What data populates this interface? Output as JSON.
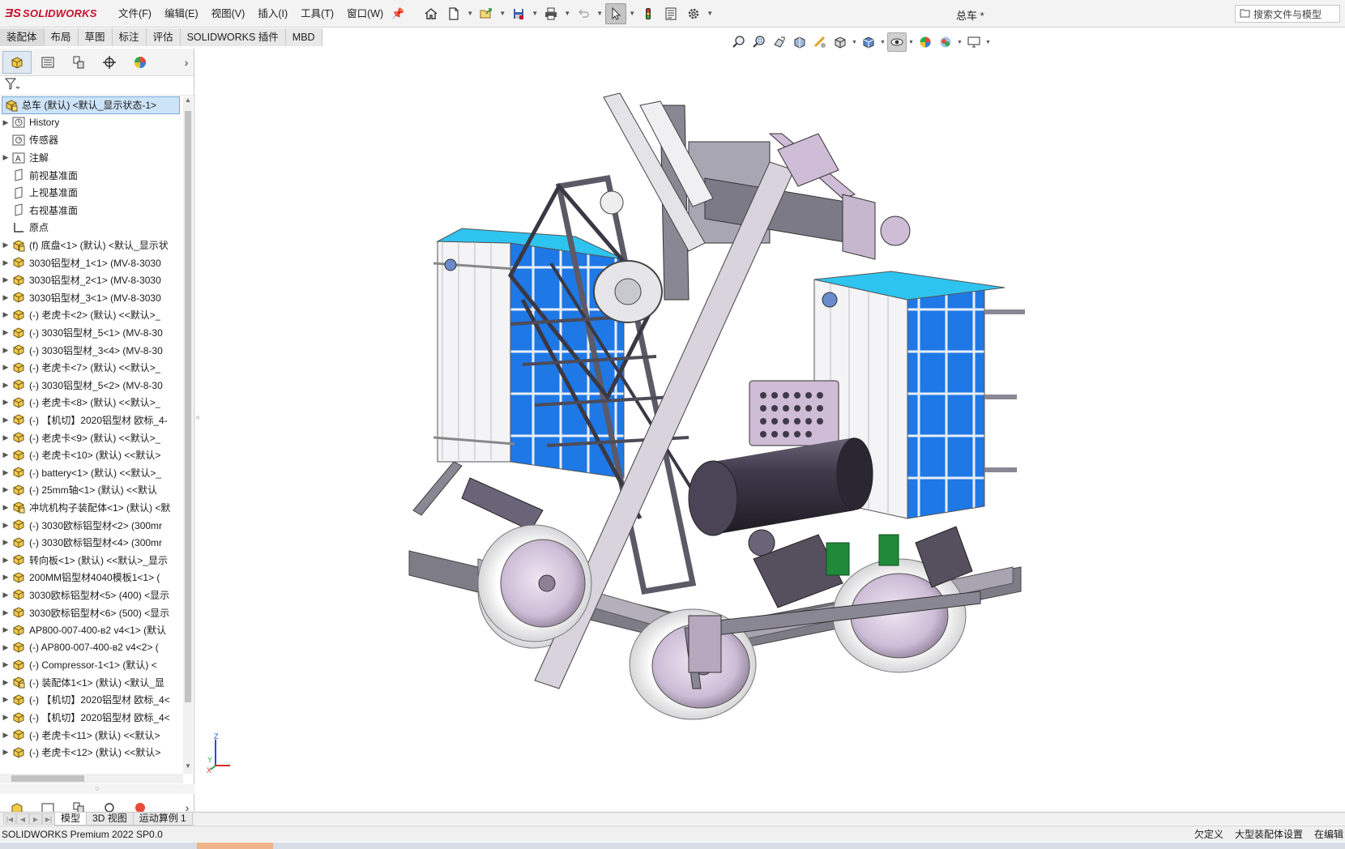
{
  "app": {
    "logo_text": "SOLIDWORKS",
    "document_title": "总车 *"
  },
  "menu": [
    "文件(F)",
    "编辑(E)",
    "视图(V)",
    "插入(I)",
    "工具(T)",
    "窗口(W)"
  ],
  "quick_access": [
    "home-icon",
    "new-document-icon",
    "open-icon",
    "save-icon",
    "print-icon",
    "undo-icon",
    "select-icon",
    "rebuild-icon",
    "file-properties-icon",
    "options-icon"
  ],
  "search": {
    "label": "搜索文件与模型"
  },
  "command_tabs": [
    "装配体",
    "布局",
    "草图",
    "标注",
    "评估",
    "SOLIDWORKS 插件",
    "MBD"
  ],
  "heads_up": [
    "zoom-to-fit-icon",
    "zoom-to-area-icon",
    "previous-view-icon",
    "section-view-icon",
    "dynamic-annotation-icon",
    "view-orientation-icon",
    "display-style-icon",
    "hide-show-items-icon",
    "edit-appearance-icon",
    "apply-scene-icon",
    "view-settings-icon"
  ],
  "feature_manager": {
    "tabs": [
      "featuremanager-tree-icon",
      "property-manager-icon",
      "configuration-manager-icon",
      "dimxpert-icon",
      "display-manager-icon"
    ],
    "root": "总车 (默认) <默认_显示状态-1>",
    "items": [
      {
        "label": "History",
        "icon": "history-icon",
        "expand": true
      },
      {
        "label": "传感器",
        "icon": "sensor-icon",
        "expand": false
      },
      {
        "label": "注解",
        "icon": "annotation-icon",
        "expand": true
      },
      {
        "label": "前视基准面",
        "icon": "plane-icon",
        "expand": false
      },
      {
        "label": "上视基准面",
        "icon": "plane-icon",
        "expand": false
      },
      {
        "label": "右视基准面",
        "icon": "plane-icon",
        "expand": false
      },
      {
        "label": "原点",
        "icon": "origin-icon",
        "expand": false
      },
      {
        "label": "(f) 底盘<1> (默认) <默认_显示状",
        "icon": "assembly-icon",
        "expand": true
      },
      {
        "label": "3030铝型材_1<1> (MV-8-3030",
        "icon": "part-icon",
        "expand": true
      },
      {
        "label": "3030铝型材_2<1> (MV-8-3030",
        "icon": "part-icon",
        "expand": true
      },
      {
        "label": "3030铝型材_3<1> (MV-8-3030",
        "icon": "part-icon",
        "expand": true
      },
      {
        "label": "(-) 老虎卡<2> (默认) <<默认>_",
        "icon": "part-icon",
        "expand": true
      },
      {
        "label": "(-) 3030铝型材_5<1> (MV-8-30",
        "icon": "part-icon",
        "expand": true
      },
      {
        "label": "(-) 3030铝型材_3<4> (MV-8-30",
        "icon": "part-icon",
        "expand": true
      },
      {
        "label": "(-) 老虎卡<7> (默认) <<默认>_",
        "icon": "part-icon",
        "expand": true
      },
      {
        "label": "(-) 3030铝型材_5<2> (MV-8-30",
        "icon": "part-icon",
        "expand": true
      },
      {
        "label": "(-) 老虎卡<8> (默认) <<默认>_",
        "icon": "part-icon",
        "expand": true
      },
      {
        "label": "(-) 【机切】2020铝型材 欧标_4-",
        "icon": "part-icon",
        "expand": true
      },
      {
        "label": "(-) 老虎卡<9> (默认) <<默认>_",
        "icon": "part-icon",
        "expand": true
      },
      {
        "label": "(-) 老虎卡<10> (默认) <<默认>",
        "icon": "part-icon",
        "expand": true
      },
      {
        "label": "(-) battery<1> (默认) <<默认>_",
        "icon": "part-icon",
        "expand": true
      },
      {
        "label": "(-) 25mm轴<1> (默认) <<默认",
        "icon": "part-icon",
        "expand": true
      },
      {
        "label": "冲坑机构子装配体<1> (默认) <默",
        "icon": "assembly-icon",
        "expand": true
      },
      {
        "label": "(-) 3030欧标铝型材<2> (300mr",
        "icon": "part-icon",
        "expand": true
      },
      {
        "label": "(-) 3030欧标铝型材<4> (300mr",
        "icon": "part-icon",
        "expand": true
      },
      {
        "label": "转向板<1> (默认) <<默认>_显示",
        "icon": "part-icon",
        "expand": true
      },
      {
        "label": "200MM铝型材4040模板1<1> (",
        "icon": "part-icon",
        "expand": true
      },
      {
        "label": "3030欧标铝型材<5> (400) <显示",
        "icon": "part-icon",
        "expand": true
      },
      {
        "label": "3030欧标铝型材<6> (500) <显示",
        "icon": "part-icon",
        "expand": true
      },
      {
        "label": "AP800-007-400-в2 v4<1> (默认",
        "icon": "part-icon",
        "expand": true
      },
      {
        "label": "(-) AP800-007-400-в2 v4<2> (",
        "icon": "part-icon",
        "expand": true
      },
      {
        "label": "(-) Compressor-1<1> (默认) <",
        "icon": "part-icon",
        "expand": true
      },
      {
        "label": "(-) 装配体1<1> (默认) <默认_显",
        "icon": "assembly-icon",
        "expand": true
      },
      {
        "label": "(-) 【机切】2020铝型材 欧标_4<",
        "icon": "part-icon",
        "expand": true
      },
      {
        "label": "(-) 【机切】2020铝型材 欧标_4<",
        "icon": "part-icon",
        "expand": true
      },
      {
        "label": "(-) 老虎卡<11> (默认) <<默认>",
        "icon": "part-icon",
        "expand": true
      },
      {
        "label": "(-) 老虎卡<12> (默认) <<默认>",
        "icon": "part-icon",
        "expand": true
      }
    ]
  },
  "bottom_tabs": [
    "模型",
    "3D 视图",
    "运动算例 1"
  ],
  "status": {
    "product": "SOLIDWORKS Premium 2022 SP0.0",
    "definition": "欠定义",
    "large_assembly": "大型装配体设置",
    "editing": "在编辑"
  },
  "triad_axes": [
    "Z",
    "Y",
    "X"
  ],
  "colors": {
    "brand": "#c8102e",
    "frame": "#8a8794",
    "panel_blue": "#1e78e6",
    "panel_cyan": "#2ec4f0",
    "tank": "#3f3a4a",
    "mauve": "#cfbcd6"
  }
}
